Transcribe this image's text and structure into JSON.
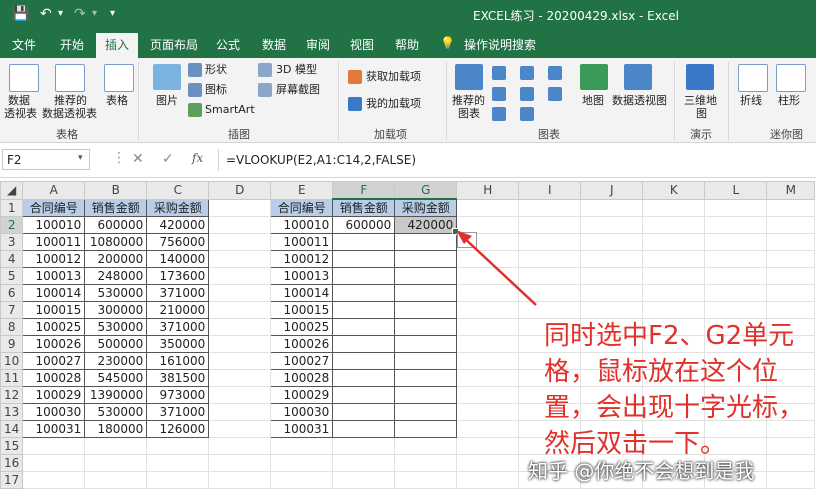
{
  "window": {
    "title": "EXCEL练习 - 20200429.xlsx  -  Excel",
    "icons": [
      "save-icon",
      "undo-icon",
      "redo-icon",
      "customize-icon"
    ]
  },
  "tabs": [
    {
      "label": "文件"
    },
    {
      "label": "开始"
    },
    {
      "label": "插入",
      "active": true
    },
    {
      "label": "页面布局"
    },
    {
      "label": "公式"
    },
    {
      "label": "数据"
    },
    {
      "label": "审阅"
    },
    {
      "label": "视图"
    },
    {
      "label": "帮助"
    },
    {
      "label": "操作说明搜索"
    }
  ],
  "ribbon": {
    "pivot_label_1": "数据",
    "pivot_label_2": "透视表",
    "rec_pivot_1": "推荐的",
    "rec_pivot_2": "数据透视表",
    "table_label": "表格",
    "group_tables": "表格",
    "pictures_label": "图片",
    "shapes_label": "形状",
    "icons_label": "图标",
    "smartart_label": "SmartArt",
    "model3d_label": "3D 模型",
    "screenshot_label": "屏幕截图",
    "group_illustrations": "插图",
    "get_addins_label": "获取加载项",
    "my_addins_label": "我的加载项",
    "group_addins": "加载项",
    "rec_charts_1": "推荐的",
    "rec_charts_2": "图表",
    "maps_label": "地图",
    "pivotchart_label": "数据透视图",
    "group_charts": "图表",
    "map3d_1": "三维地",
    "map3d_2": "图",
    "group_tours": "演示",
    "line_label": "折线",
    "column_label": "柱形",
    "group_sparklines": "迷你图"
  },
  "formula_bar": {
    "name_box": "F2",
    "cancel": "✕",
    "enter": "✓",
    "fx": "fx",
    "formula": "=VLOOKUP(E2,A1:C14,2,FALSE)"
  },
  "grid": {
    "columns": [
      "A",
      "B",
      "C",
      "D",
      "E",
      "F",
      "G",
      "H",
      "I",
      "J",
      "K",
      "L",
      "M"
    ],
    "rows": [
      "1",
      "2",
      "3",
      "4",
      "5",
      "6",
      "7",
      "8",
      "9",
      "10",
      "11",
      "12",
      "13",
      "14",
      "15",
      "16",
      "17"
    ],
    "left_table": {
      "headers": [
        "合同编号",
        "销售金额",
        "采购金额"
      ],
      "rows": [
        [
          "100010",
          "600000",
          "420000"
        ],
        [
          "100011",
          "1080000",
          "756000"
        ],
        [
          "100012",
          "200000",
          "140000"
        ],
        [
          "100013",
          "248000",
          "173600"
        ],
        [
          "100014",
          "530000",
          "371000"
        ],
        [
          "100015",
          "300000",
          "210000"
        ],
        [
          "100025",
          "530000",
          "371000"
        ],
        [
          "100026",
          "500000",
          "350000"
        ],
        [
          "100027",
          "230000",
          "161000"
        ],
        [
          "100028",
          "545000",
          "381500"
        ],
        [
          "100029",
          "1390000",
          "973000"
        ],
        [
          "100030",
          "530000",
          "371000"
        ],
        [
          "100031",
          "180000",
          "126000"
        ]
      ]
    },
    "right_table": {
      "headers": [
        "合同编号",
        "销售金额",
        "采购金额"
      ],
      "ids": [
        "100010",
        "100011",
        "100012",
        "100013",
        "100014",
        "100015",
        "100025",
        "100026",
        "100027",
        "100028",
        "100029",
        "100030",
        "100031"
      ],
      "f2": "600000",
      "g2": "420000"
    }
  },
  "annotation": {
    "text": "同时选中F2、G2单元格，鼠标放在这个位置，会出现十字光标，然后双击一下。",
    "color": "#e0322b"
  },
  "watermark": "知乎 @你绝不会想到是我",
  "colors": {
    "accent": "#217346",
    "header_fill": "#b7cde8",
    "arrow": "#e0322b"
  }
}
